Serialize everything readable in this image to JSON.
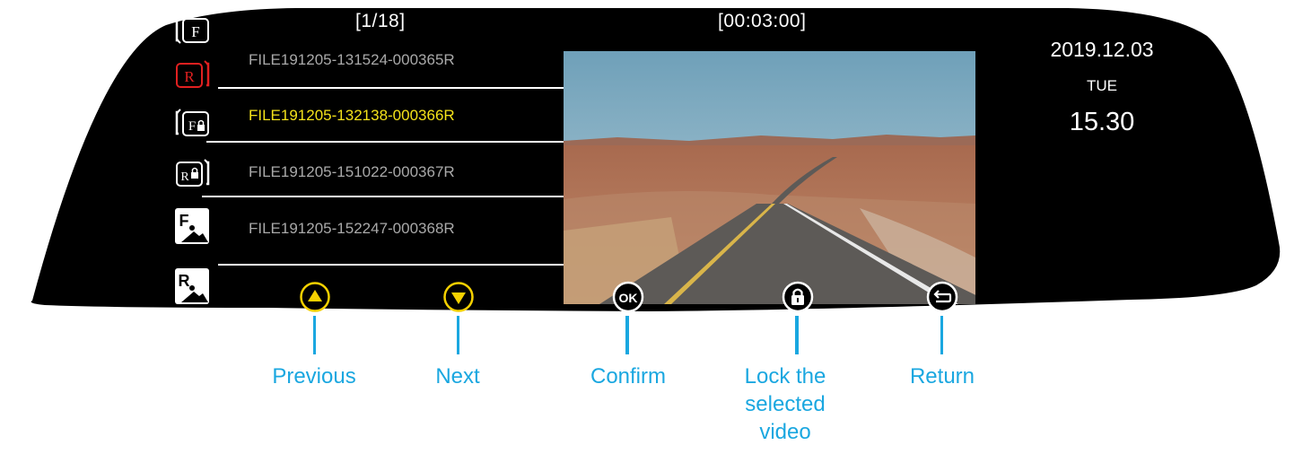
{
  "colors": {
    "mirror_bg": "#000000",
    "selected_text": "#f4e21a",
    "file_text": "#a9a9a9",
    "accent_yellow": "#f5d100",
    "callout_blue": "#1aa7e0",
    "recording_red": "#e02020"
  },
  "header": {
    "page_counter": "[1/18]",
    "duration": "[00:03:00]"
  },
  "clock": {
    "date": "2019.12.03",
    "weekday": "TUE",
    "time": "15.30"
  },
  "mode_icons": [
    {
      "name": "front-video-icon",
      "glyph": "F"
    },
    {
      "name": "rear-video-icon",
      "glyph": "R",
      "active": true
    },
    {
      "name": "front-locked-video-icon",
      "glyph": "F"
    },
    {
      "name": "rear-locked-video-icon",
      "glyph": "R"
    },
    {
      "name": "front-photo-icon",
      "glyph": "F"
    },
    {
      "name": "rear-photo-icon",
      "glyph": "R"
    }
  ],
  "files": [
    {
      "label": "FILE191205-131524-000365R",
      "selected": false
    },
    {
      "label": "FILE191205-132138-000366R",
      "selected": true
    },
    {
      "label": "FILE191205-151022-000367R",
      "selected": false
    },
    {
      "label": "FILE191205-152247-000368R",
      "selected": false
    }
  ],
  "preview": {
    "scene": "desert-road-icon"
  },
  "controls": {
    "previous": {
      "icon": "up-arrow-icon",
      "label": "Previous"
    },
    "next": {
      "icon": "down-arrow-icon",
      "label": "Next"
    },
    "confirm": {
      "icon": "ok-icon",
      "glyph": "OK",
      "label": "Confirm"
    },
    "lock": {
      "icon": "lock-icon",
      "label_lines": [
        "Lock the",
        "selected",
        "video"
      ]
    },
    "return": {
      "icon": "return-icon",
      "label": "Return"
    }
  }
}
